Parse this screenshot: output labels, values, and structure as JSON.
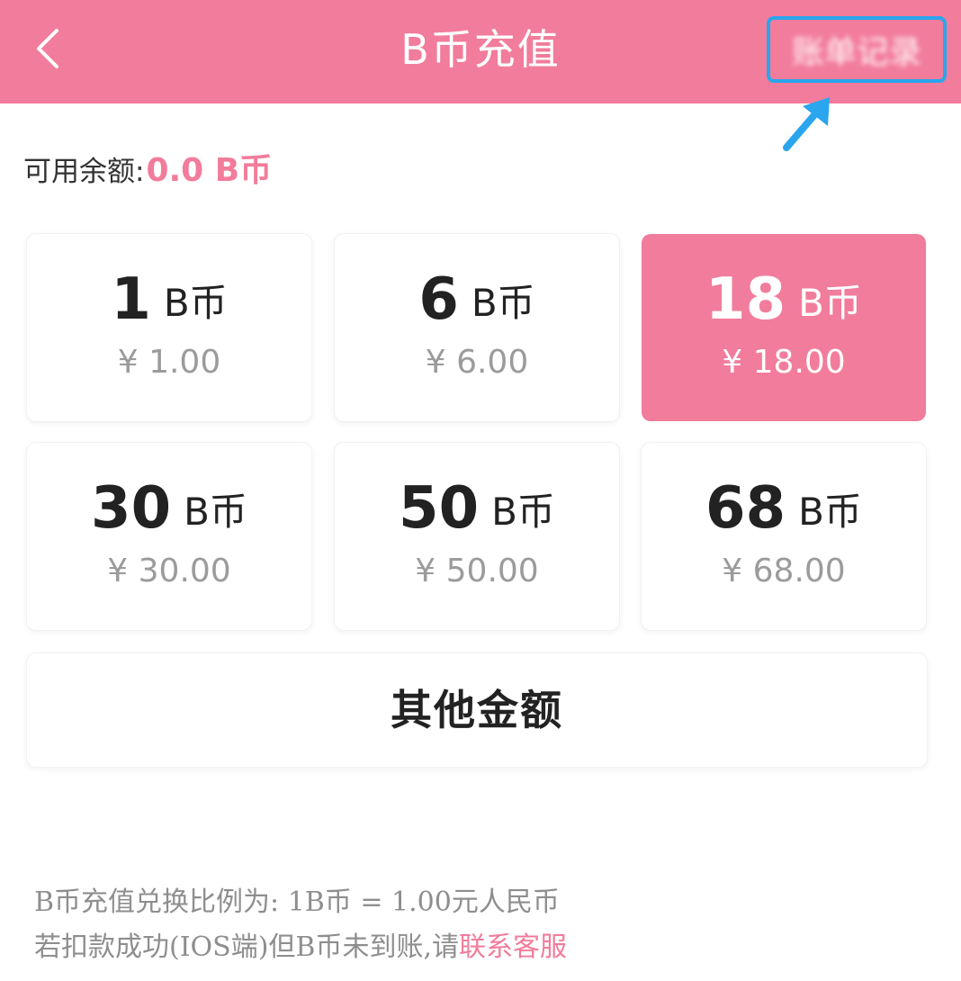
{
  "header": {
    "back_icon": "chevron-left-icon",
    "title": "B币充值",
    "right_action_blurred": "账单记录"
  },
  "colors": {
    "brand": "#f27c9b",
    "highlight_border": "#29a6ee"
  },
  "balance": {
    "label": "可用余额:",
    "amount": "0.0 B币"
  },
  "options": [
    {
      "coins": "1",
      "unit": "B币",
      "price": "¥ 1.00",
      "selected": false
    },
    {
      "coins": "6",
      "unit": "B币",
      "price": "¥ 6.00",
      "selected": false
    },
    {
      "coins": "18",
      "unit": "B币",
      "price": "¥ 18.00",
      "selected": true
    },
    {
      "coins": "30",
      "unit": "B币",
      "price": "¥ 30.00",
      "selected": false
    },
    {
      "coins": "50",
      "unit": "B币",
      "price": "¥ 50.00",
      "selected": false
    },
    {
      "coins": "68",
      "unit": "B币",
      "price": "¥ 68.00",
      "selected": false
    }
  ],
  "other_amount_label": "其他金额",
  "notes": {
    "rate": "B币充值兑换比例为:  1B币 = 1.00元人民币",
    "issue_prefix": "若扣款成功(IOS端)但B币未到账,请",
    "contact_link": "联系客服"
  }
}
